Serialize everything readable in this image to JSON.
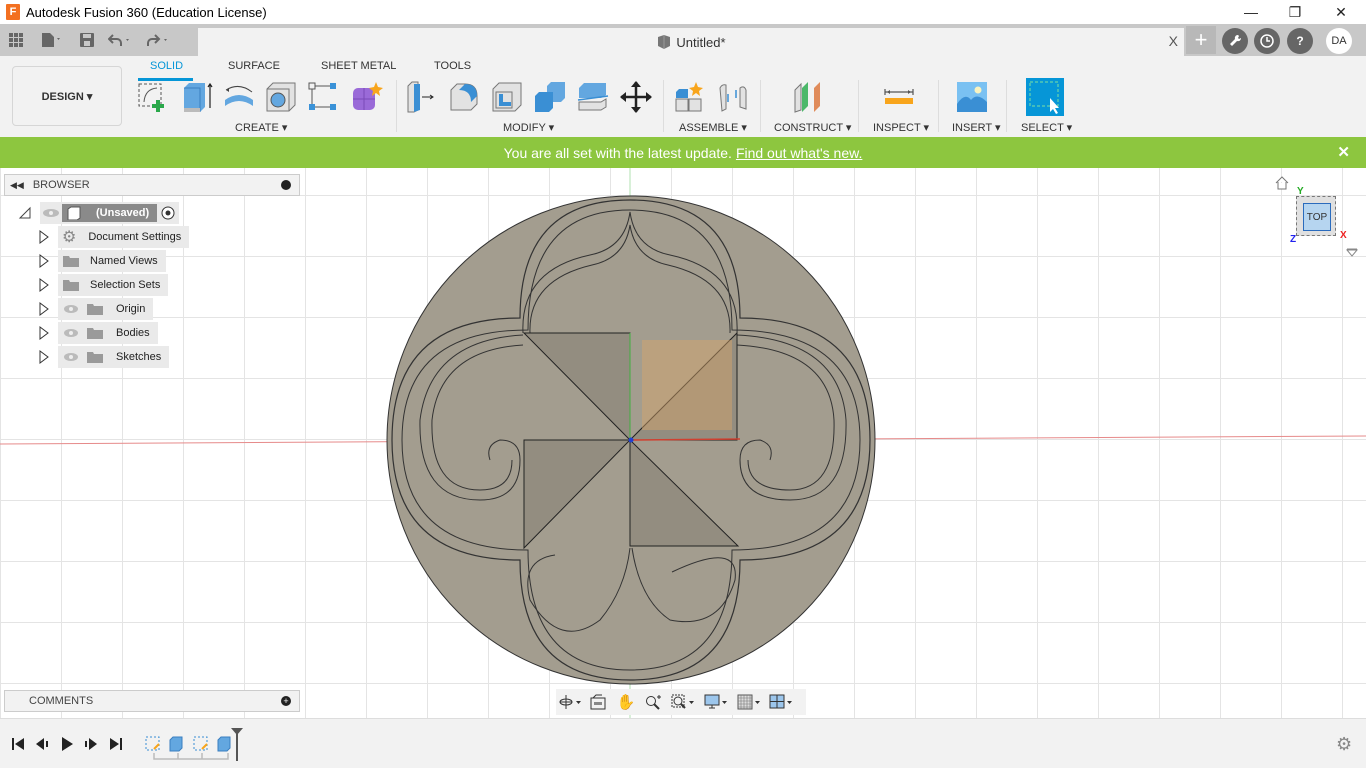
{
  "window": {
    "title": "Autodesk Fusion 360 (Education License)",
    "app_icon_letter": "F",
    "controls": {
      "minimize": "—",
      "restore": "❐",
      "close": "✕"
    }
  },
  "quick_access": {
    "icons": [
      "grid-icon",
      "file-icon",
      "save-icon",
      "undo-icon",
      "redo-icon"
    ]
  },
  "document_tab": {
    "label": "Untitled*",
    "close": "X"
  },
  "top_right": {
    "new_tab": "+",
    "user_initials": "DA"
  },
  "ribbon": {
    "workspace": "DESIGN ▾",
    "tabs": [
      {
        "label": "SOLID",
        "active": true
      },
      {
        "label": "SURFACE",
        "active": false
      },
      {
        "label": "SHEET METAL",
        "active": false
      },
      {
        "label": "TOOLS",
        "active": false
      }
    ],
    "groups": [
      {
        "label": "CREATE ▾",
        "tools": [
          "create-sketch",
          "extrude",
          "revolve",
          "hole",
          "pattern",
          "create-form"
        ]
      },
      {
        "label": "MODIFY ▾",
        "tools": [
          "press-pull",
          "fillet",
          "shell",
          "combine",
          "split-body",
          "move-copy"
        ]
      },
      {
        "label": "ASSEMBLE ▾",
        "tools": [
          "new-component",
          "joint"
        ]
      },
      {
        "label": "CONSTRUCT ▾",
        "tools": [
          "offset-plane"
        ]
      },
      {
        "label": "INSPECT ▾",
        "tools": [
          "measure"
        ]
      },
      {
        "label": "INSERT ▾",
        "tools": [
          "insert-image"
        ]
      },
      {
        "label": "SELECT ▾",
        "tools": [
          "select"
        ]
      }
    ]
  },
  "banner": {
    "message": "You are all set with the latest update.",
    "link": "Find out what's new.",
    "close": "✕",
    "color": "#8dc63f"
  },
  "browser": {
    "title": "BROWSER",
    "root": "(Unsaved)",
    "items": [
      {
        "label": "Document Settings",
        "icon": "gear-icon",
        "visible_toggle": false
      },
      {
        "label": "Named Views",
        "icon": "folder-icon",
        "visible_toggle": false
      },
      {
        "label": "Selection Sets",
        "icon": "folder-icon",
        "visible_toggle": false
      },
      {
        "label": "Origin",
        "icon": "folder-icon",
        "visible_toggle": true
      },
      {
        "label": "Bodies",
        "icon": "folder-icon",
        "visible_toggle": true
      },
      {
        "label": "Sketches",
        "icon": "folder-icon",
        "visible_toggle": true
      }
    ]
  },
  "viewcube": {
    "face": "TOP",
    "axes": {
      "x": "X",
      "y": "Y",
      "z": "Z"
    }
  },
  "comments": {
    "title": "COMMENTS"
  },
  "nav_toolbar": {
    "tools": [
      "orbit",
      "look-at",
      "pan",
      "zoom",
      "fit",
      "display-settings",
      "grid-snaps",
      "viewports"
    ]
  },
  "timeline": {
    "controls": [
      "first",
      "previous",
      "play",
      "next",
      "last"
    ],
    "features": [
      "sketch",
      "extrude",
      "sketch",
      "extrude"
    ]
  },
  "colors": {
    "accent": "#0696d7",
    "body": "#a39d8f",
    "selection": "#d9a66a"
  }
}
